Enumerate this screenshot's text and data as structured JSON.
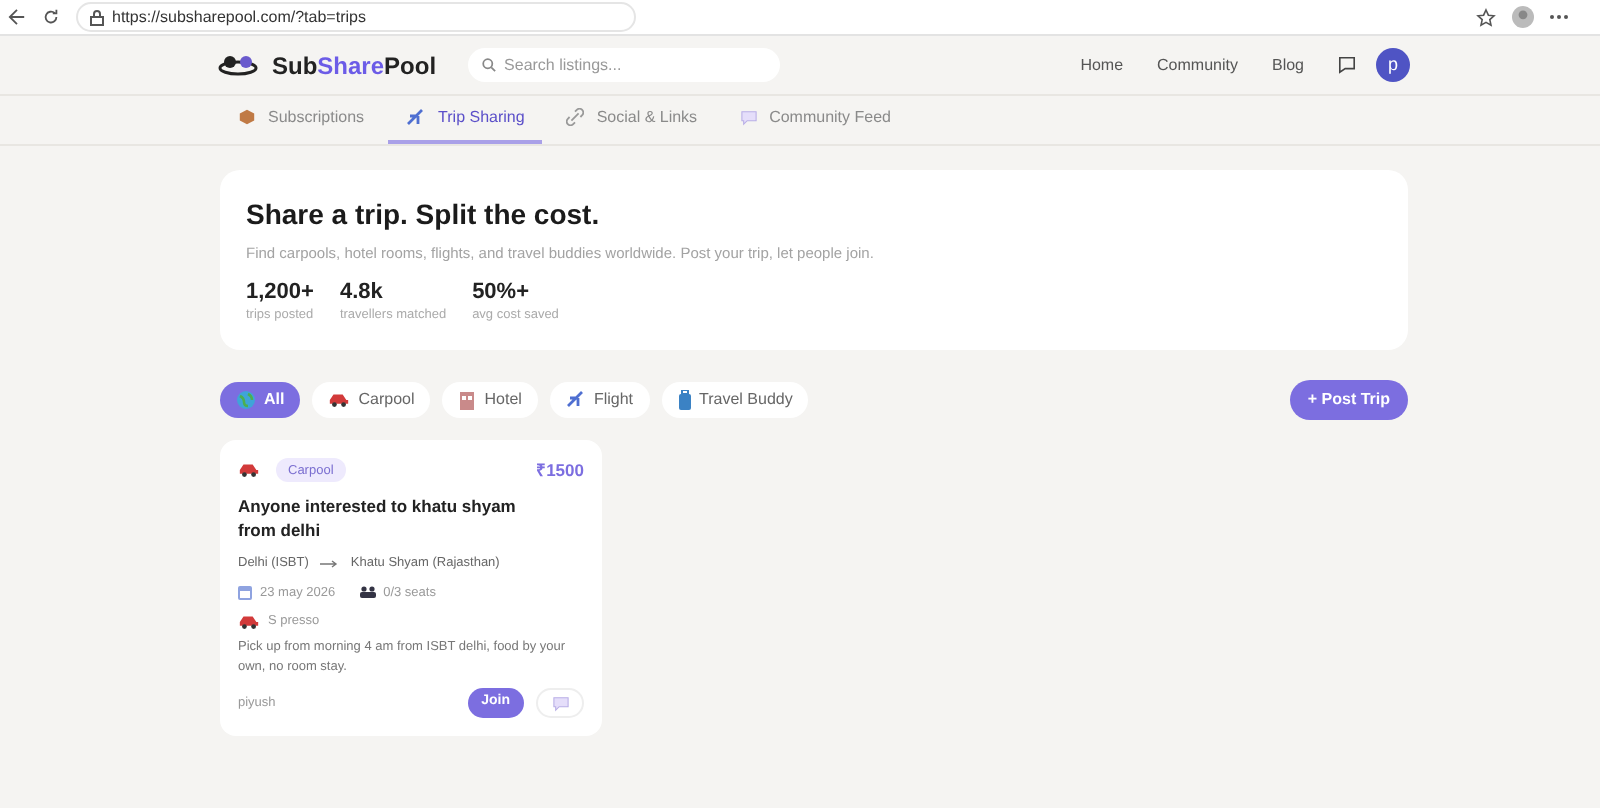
{
  "browser": {
    "url": "https://subsharepool.com/?tab=trips"
  },
  "header": {
    "brand": [
      "Sub",
      "Share",
      "Pool"
    ],
    "search": {
      "placeholder": "Search listings..."
    },
    "nav": [
      "Home",
      "Community",
      "Blog"
    ],
    "avatar": "p"
  },
  "tabs": [
    {
      "label": "Subscriptions",
      "kind": "box",
      "selected": false
    },
    {
      "label": "Trip Sharing",
      "kind": "plane",
      "selected": true
    },
    {
      "label": "Social & Links",
      "kind": "link",
      "selected": false
    },
    {
      "label": "Community Feed",
      "kind": "chat",
      "selected": false
    }
  ],
  "hero": {
    "title": "Share a trip. Split the cost.",
    "subtitle": "Find carpools, hotel rooms, flights, and travel buddies worldwide. Post your trip, let people join.",
    "stats": [
      {
        "value": "1,200+",
        "label": "trips posted"
      },
      {
        "value": "4.8k",
        "label": "travellers matched"
      },
      {
        "value": "50%+",
        "label": "avg cost saved"
      }
    ]
  },
  "filters": [
    {
      "label": "All",
      "kind": "globe",
      "selected": true
    },
    {
      "label": "Carpool",
      "kind": "car",
      "selected": false
    },
    {
      "label": "Hotel",
      "kind": "hotel",
      "selected": false
    },
    {
      "label": "Flight",
      "kind": "plane",
      "selected": false
    },
    {
      "label": "Travel Buddy",
      "kind": "luggage",
      "selected": false
    }
  ],
  "post_button": "+ Post Trip",
  "listings": [
    {
      "kind": "car",
      "category": "Carpool",
      "price": "₹1500",
      "title": "Anyone interested to khatu shyam from delhi",
      "from": "Delhi (ISBT)",
      "to": "Khatu Shyam (Rajasthan)",
      "date": "23 may 2026",
      "seats": "0/3 seats",
      "vehicle": "S presso",
      "description": "Pick up from morning 4 am from ISBT delhi, food by your own, no room stay.",
      "user": "piyush",
      "join": "Join"
    }
  ]
}
